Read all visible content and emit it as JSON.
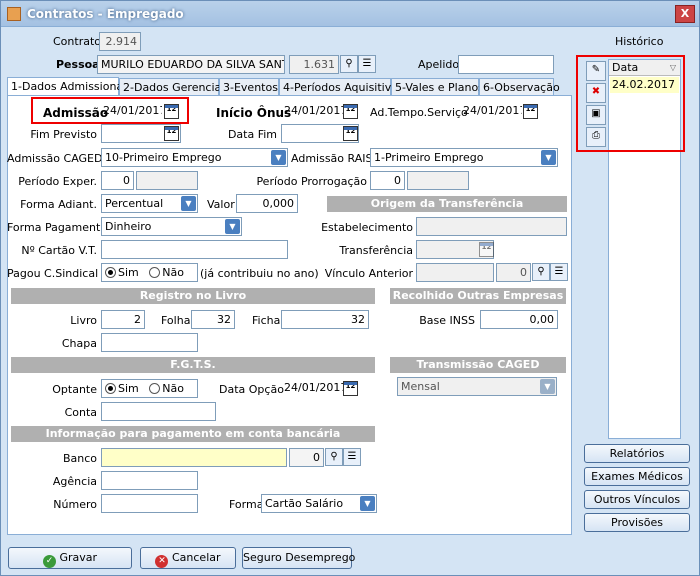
{
  "window": {
    "title": "Contratos - Empregado",
    "close": "X"
  },
  "header": {
    "contrato_label": "Contrato",
    "contrato_value": "2.914",
    "pessoa_label": "Pessoa",
    "pessoa_name": "MURILO EDUARDO DA SILVA SANTOS",
    "pessoa_code": "1.631",
    "apelido_label": "Apelido",
    "apelido_value": ""
  },
  "tabs": [
    "1-Dados Admissionais",
    "2-Dados Gerenciais",
    "3-Eventos",
    "4-Períodos Aquisitivos",
    "5-Vales e Planos",
    "6-Observação"
  ],
  "form": {
    "admissao_label": "Admissão",
    "admissao_value": "24/01/2017",
    "inicio_onus_label": "Início Ônus",
    "inicio_onus_value": "24/01/2017",
    "ad_tempo_label": "Ad.Tempo.Serviço",
    "ad_tempo_value": "24/01/2017",
    "fim_previsto_label": "Fim Previsto",
    "fim_previsto_value": "",
    "data_fim_label": "Data Fim",
    "data_fim_value": "",
    "adm_caged_label": "Admissão CAGED",
    "adm_caged_value": "10-Primeiro Emprego",
    "adm_rais_label": "Admissão RAIS",
    "adm_rais_value": "1-Primeiro Emprego",
    "periodo_exper_label": "Período Exper.",
    "periodo_exper_value": "0",
    "periodo_prorrog_label": "Período Prorrogação",
    "periodo_prorrog_value": "0",
    "forma_adiant_label": "Forma Adiant.",
    "forma_adiant_value": "Percentual",
    "valor_label": "Valor",
    "valor_value": "0,000",
    "origem_header": "Origem da Transferência",
    "forma_pag_label": "Forma Pagamento",
    "forma_pag_value": "Dinheiro",
    "estabelecimento_label": "Estabelecimento",
    "estabelecimento_value": "",
    "cartao_vt_label": "Nº Cartão V.T.",
    "cartao_vt_value": "",
    "transferencia_label": "Transferência",
    "transferencia_value": "",
    "pagou_label": "Pagou C.Sindical",
    "sim": "Sim",
    "nao": "Não",
    "ja_contribuiu": "(já contribuiu no ano)",
    "vinculo_label": "Vínculo Anterior",
    "vinculo_code": "0",
    "registro_header": "Registro no Livro",
    "recolhido_header": "Recolhido Outras Empresas",
    "livro_label": "Livro",
    "livro_value": "2",
    "folha_label": "Folha",
    "folha_value": "32",
    "ficha_label": "Ficha",
    "ficha_value": "32",
    "base_inss_label": "Base INSS",
    "base_inss_value": "0,00",
    "chapa_label": "Chapa",
    "chapa_value": "",
    "fgts_header": "F.G.T.S.",
    "transmissao_header": "Transmissão CAGED",
    "optante_label": "Optante",
    "data_opcao_label": "Data Opção",
    "data_opcao_value": "24/01/2017",
    "transmissao_value": "Mensal",
    "conta_label": "Conta",
    "conta_value": "",
    "banco_header": "Informação para pagamento em conta bancária",
    "banco_label": "Banco",
    "banco_value": "",
    "banco_code": "0",
    "agencia_label": "Agência",
    "agencia_value": "",
    "numero_label": "Número",
    "numero_value": "",
    "forma_label": "Forma",
    "forma_value": "Cartão Salário",
    "cal_glyph": "12"
  },
  "historico": {
    "title": "Histórico",
    "col": "Data",
    "rows": [
      "24.02.2017"
    ]
  },
  "side_buttons": [
    "Relatórios",
    "Exames Médicos",
    "Outros Vínculos",
    "Provisões"
  ],
  "bottom_buttons": {
    "gravar": "Gravar",
    "cancelar": "Cancelar",
    "seguro": "Seguro Desemprego"
  }
}
